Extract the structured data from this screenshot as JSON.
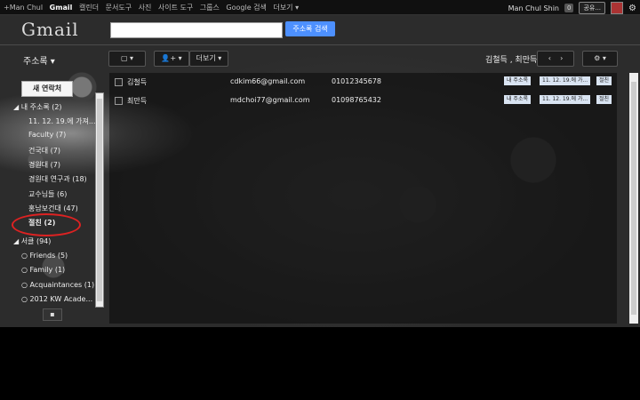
{
  "topbar": {
    "items": [
      "+Man Chul",
      "Gmail",
      "캘린더",
      "문서도구",
      "사진",
      "사이트 도구",
      "그룹스",
      "Google 검색",
      "더보기 ▾"
    ],
    "user_name": "Man Chul Shin",
    "notification_count": "0",
    "share_label": "공유..."
  },
  "header": {
    "logo": "Gmail",
    "search_value": "",
    "search_button": "주소록 검색"
  },
  "toolbar": {
    "contacts_menu": "주소록 ▾",
    "more_button": "더보기 ▾",
    "selected_names": "김철득 , 최만득"
  },
  "sidebar": {
    "new_contact": "새 연락처",
    "my_contacts": "◢ 내 주소록 (2)",
    "items": [
      "11. 12. 19.에 가져...",
      "Faculty (7)",
      "건국대 (7)",
      "경원대 (7)",
      "경원대 연구과 (18)",
      "교수님들 (6)",
      "홍남보건대 (47)",
      "절친 (2)"
    ],
    "circles_header": "◢ 서클 (94)",
    "circles": [
      "Friends (5)",
      "Family (1)",
      "Acquaintances (1)",
      "2012 KW Acade..."
    ]
  },
  "contacts": [
    {
      "name": "김철득",
      "email": "cdkim66@gmail.com",
      "phone": "01012345678",
      "labels": [
        "내 주소록",
        "11. 12. 19.에 가...",
        "절친"
      ]
    },
    {
      "name": "최만득",
      "email": "mdchoi77@gmail.com",
      "phone": "01098765432",
      "labels": [
        "내 주소록",
        "11. 12. 19.에 가...",
        "절친"
      ]
    }
  ]
}
